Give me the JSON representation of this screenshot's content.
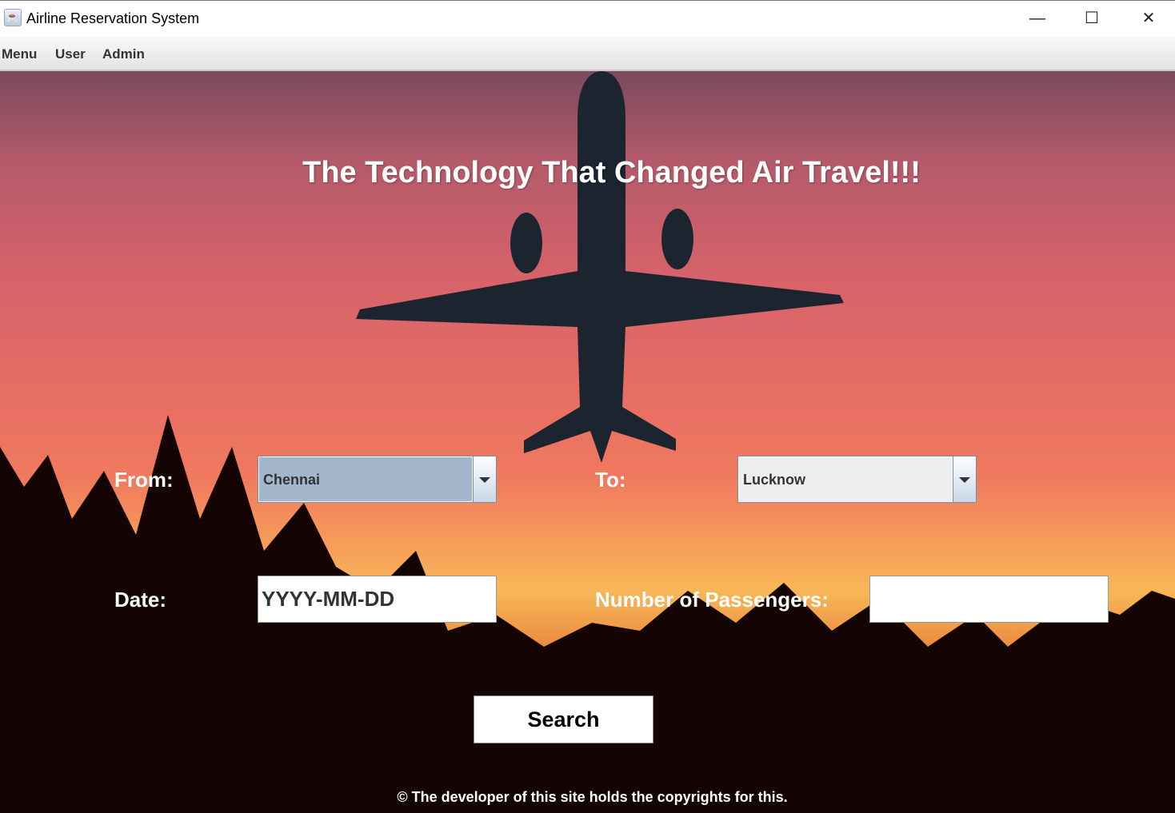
{
  "window": {
    "title": "Airline Reservation System",
    "icon": "java-cup-icon",
    "minimize": "—",
    "maximize": "☐",
    "close": "✕"
  },
  "menubar": {
    "items": [
      "Menu",
      "User",
      "Admin"
    ]
  },
  "main": {
    "headline": "The Technology That Changed Air Travel!!!",
    "from_label": "From:",
    "from_value": "Chennai",
    "to_label": "To:",
    "to_value": "Lucknow",
    "date_label": "Date:",
    "date_value": "YYYY-MM-DD",
    "passengers_label": "Number of Passengers:",
    "passengers_value": "",
    "search_label": "Search",
    "footer": "© The developer of this site holds the copyrights for this."
  },
  "colors": {
    "from_combo_bg": "#a3b6cb",
    "to_combo_bg": "#eeeeee"
  }
}
